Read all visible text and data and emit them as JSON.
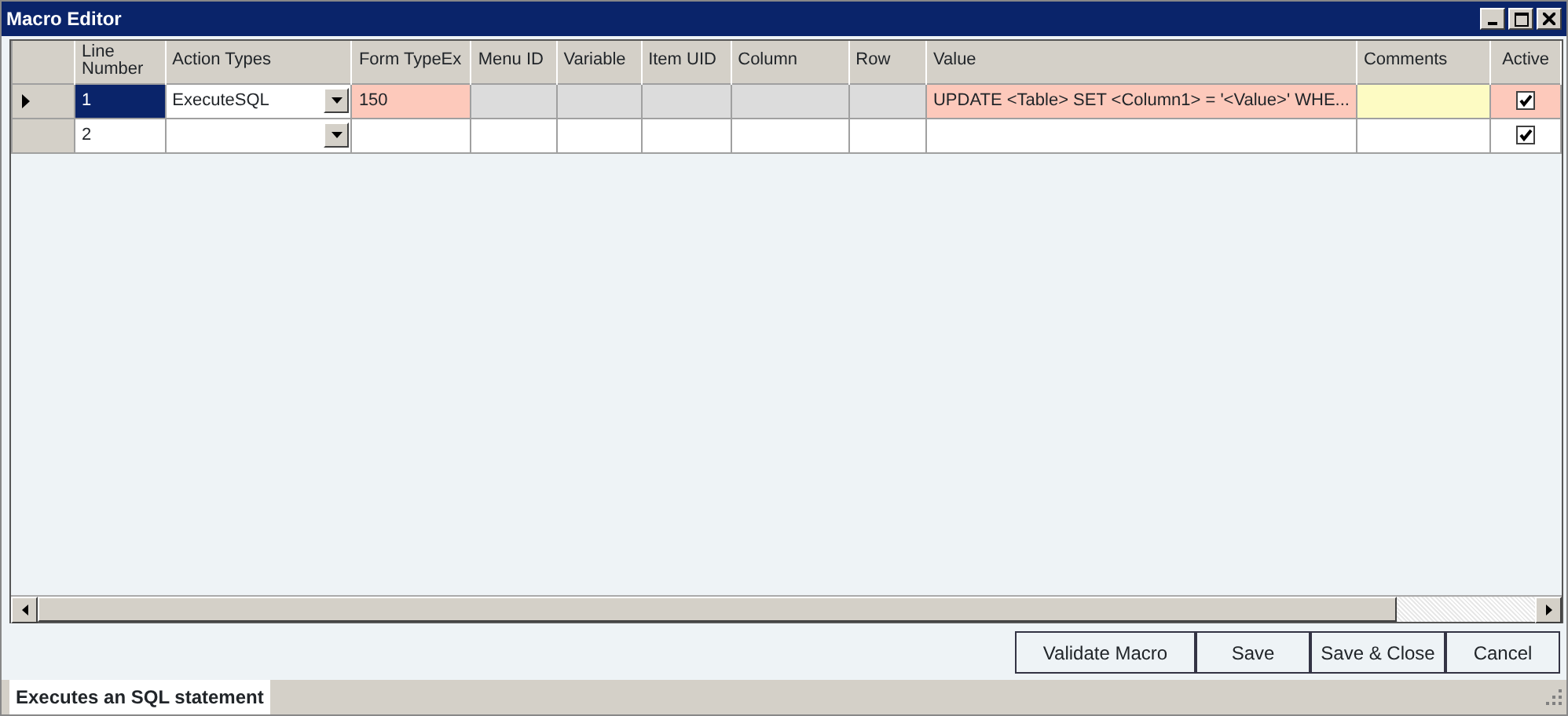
{
  "window": {
    "title": "Macro Editor"
  },
  "table": {
    "columns": [
      "Line Number",
      "Action Types",
      "Form TypeEx",
      "Menu ID",
      "Variable",
      "Item UID",
      "Column",
      "Row",
      "Value",
      "Comments",
      "Active"
    ],
    "rows": [
      {
        "selected": true,
        "cells": [
          {
            "kind": "text",
            "text": "1",
            "color": "#0a246a"
          },
          {
            "kind": "combo",
            "text": "ExecuteSQL",
            "color": "#ffffff"
          },
          {
            "kind": "text",
            "text": "150",
            "color": "#fdc9bb"
          },
          {
            "kind": "text",
            "color": "#dcdcdc"
          },
          {
            "kind": "text",
            "color": "#dcdcdc"
          },
          {
            "kind": "text",
            "color": "#dcdcdc"
          },
          {
            "kind": "text",
            "color": "#dcdcdc"
          },
          {
            "kind": "text",
            "color": "#dcdcdc"
          },
          {
            "kind": "text",
            "text": "UPDATE <Table> SET <Column1> = '<Value>' WHE...",
            "color": "#fdc9bb"
          },
          {
            "kind": "text",
            "color": "#fdfbc3"
          },
          {
            "kind": "check",
            "checked": true,
            "color": "#fdc9bb"
          }
        ]
      },
      {
        "selected": false,
        "cells": [
          {
            "kind": "text",
            "text": "2",
            "color": "#ffffff"
          },
          {
            "kind": "combo",
            "color": "#ffffff"
          },
          {
            "kind": "text",
            "color": "#ffffff"
          },
          {
            "kind": "text",
            "color": "#ffffff"
          },
          {
            "kind": "text",
            "color": "#ffffff"
          },
          {
            "kind": "text",
            "color": "#ffffff"
          },
          {
            "kind": "text",
            "color": "#ffffff"
          },
          {
            "kind": "text",
            "color": "#ffffff"
          },
          {
            "kind": "text",
            "color": "#ffffff"
          },
          {
            "kind": "text",
            "color": "#ffffff"
          },
          {
            "kind": "check",
            "checked": true,
            "color": "#ffffff"
          }
        ]
      }
    ]
  },
  "buttons": [
    "Validate Macro",
    "Save",
    "Save & Close",
    "Cancel"
  ],
  "status_bar": "Executes an SQL statement"
}
